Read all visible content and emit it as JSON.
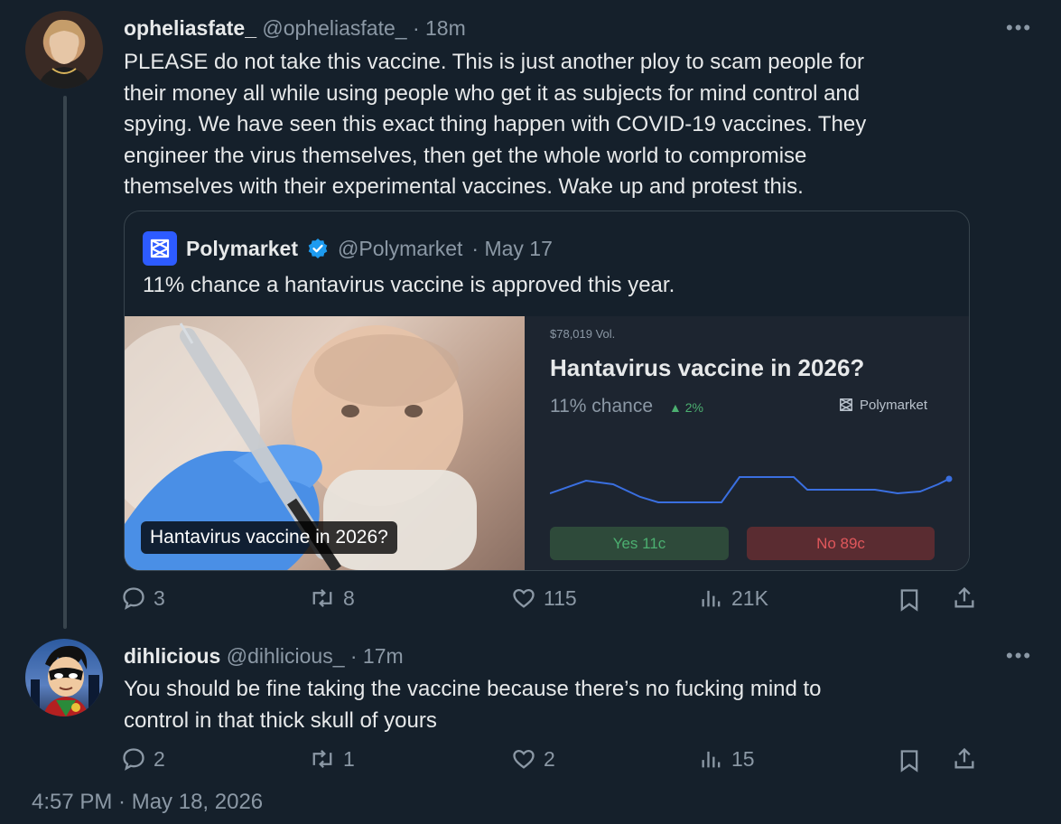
{
  "post1": {
    "display_name": "opheliasfate_",
    "handle": "@opheliasfate_",
    "time": "· 18m",
    "text_lines": [
      "PLEASE do not take this vaccine. This is just another ploy to scam people for",
      "their money all while using people who get it as subjects for mind control and",
      "spying. We have seen this exact thing happen with COVID-19 vaccines. They",
      "engineer the virus themselves, then get the whole world to compromise",
      "themselves with their experimental vaccines. Wake up and protest this."
    ],
    "replies": "3",
    "reposts": "8",
    "likes": "115",
    "views": "21K"
  },
  "quote": {
    "display_name": "Polymarket",
    "handle": "@Polymarket",
    "time": "· May 17",
    "text": "11% chance a hantavirus vaccine is approved this year.",
    "image_caption": "Hantavirus vaccine in 2026?",
    "card": {
      "volume": "$78,019 Vol.",
      "title": "Hantavirus vaccine in 2026?",
      "chance": "11% chance",
      "change": "▲ 2%",
      "brand": "Polymarket",
      "yes_label": "Yes 11c",
      "no_label": "No 89c"
    }
  },
  "post2": {
    "display_name": "dihlicious",
    "handle": "@dihlicious_",
    "time": "· 17m",
    "text_lines": [
      "You should be fine taking the vaccine because there’s no fucking mind to",
      "control in that thick skull of yours"
    ],
    "replies": "2",
    "reposts": "1",
    "likes": "2",
    "views": "15"
  },
  "timestamp": "4:57 PM · May 18, 2026",
  "colors": {
    "background": "#15202b",
    "text": "#e7e9ea",
    "muted": "#8b98a5",
    "verified": "#1d9bf0",
    "polymarket_brand": "#2d5bff",
    "yes": "#4caf70",
    "no": "#e0575b"
  }
}
